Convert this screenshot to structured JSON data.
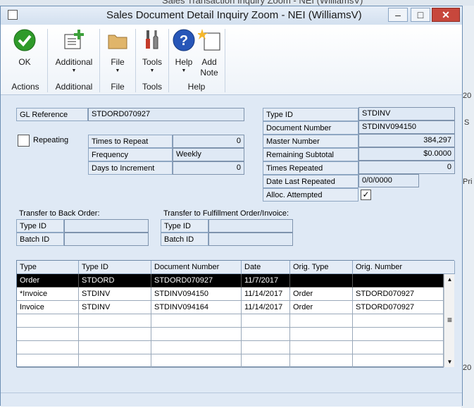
{
  "background": {
    "title_partial": "Sales Transaction Inquiry Zoom - NEI (WilliamsV)",
    "right_fragments": [
      "20",
      "S",
      "Pri",
      "20"
    ]
  },
  "window": {
    "title": "Sales Document Detail Inquiry Zoom  -  NEI (WilliamsV)",
    "min_glyph": "–",
    "max_glyph": "□",
    "close_glyph": "✕"
  },
  "ribbon": {
    "buttons": {
      "ok": "OK",
      "additional": "Additional",
      "file": "File",
      "tools": "Tools",
      "help": "Help",
      "add_note_1": "Add",
      "add_note_2": "Note"
    },
    "groups": {
      "actions": "Actions",
      "additional": "Additional",
      "file": "File",
      "tools": "Tools",
      "help": "Help"
    },
    "dropdown_arrow": "▼"
  },
  "form": {
    "gl_reference_label": "GL Reference",
    "gl_reference_value": "STDORD070927",
    "repeating_label": "Repeating",
    "times_to_repeat_label": "Times to Repeat",
    "times_to_repeat_value": "0",
    "frequency_label": "Frequency",
    "frequency_value": "Weekly",
    "days_to_increment_label": "Days to Increment",
    "days_to_increment_value": "0",
    "type_id_label": "Type ID",
    "type_id_value": "STDINV",
    "document_number_label": "Document Number",
    "document_number_value": "STDINV094150",
    "master_number_label": "Master Number",
    "master_number_value": "384,297",
    "remaining_subtotal_label": "Remaining Subtotal",
    "remaining_subtotal_value": "$0.0000",
    "times_repeated_label": "Times Repeated",
    "times_repeated_value": "0",
    "date_last_repeated_label": "Date Last Repeated",
    "date_last_repeated_value": "0/0/0000",
    "alloc_attempted_label": "Alloc. Attempted",
    "alloc_attempted_check": "✓",
    "transfer_back_order_title": "Transfer to Back Order:",
    "transfer_fulfillment_title": "Transfer to Fulfillment Order/Invoice:",
    "tbo_type_id_label": "Type ID",
    "tbo_batch_id_label": "Batch ID",
    "tfo_type_id_label": "Type ID",
    "tfo_batch_id_label": "Batch ID"
  },
  "grid": {
    "headers": [
      "Type",
      "Type ID",
      "Document Number",
      "Date",
      "Orig. Type",
      "Orig. Number"
    ],
    "rows": [
      [
        "Order",
        "STDORD",
        "STDORD070927",
        "11/7/2017",
        "",
        ""
      ],
      [
        "*Invoice",
        "STDINV",
        "STDINV094150",
        "11/14/2017",
        "Order",
        "STDORD070927"
      ],
      [
        "Invoice",
        "STDINV",
        "STDINV094164",
        "11/14/2017",
        "Order",
        "STDORD070927"
      ],
      [
        "",
        "",
        "",
        "",
        "",
        ""
      ],
      [
        "",
        "",
        "",
        "",
        "",
        ""
      ],
      [
        "",
        "",
        "",
        "",
        "",
        ""
      ],
      [
        "",
        "",
        "",
        "",
        "",
        ""
      ]
    ],
    "scroll_up": "▲",
    "scroll_down": "▼",
    "scroll_grip": "≡"
  }
}
